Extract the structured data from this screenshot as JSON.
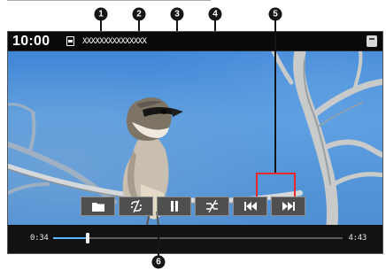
{
  "status_bar": {
    "clock": "10:00",
    "filename": "XXXXXXXXXXXXXXX",
    "media_icon": "sd-card-icon",
    "menu_icon": "menu-icon"
  },
  "controls": [
    {
      "id": "folder",
      "icon": "folder-icon"
    },
    {
      "id": "repeat",
      "icon": "repeat-off-icon"
    },
    {
      "id": "play-pause",
      "icon": "pause-icon"
    },
    {
      "id": "shuffle",
      "icon": "shuffle-off-icon"
    },
    {
      "id": "previous",
      "icon": "skip-previous-icon"
    },
    {
      "id": "next",
      "icon": "skip-next-icon"
    }
  ],
  "seek": {
    "current_time": "0:34",
    "total_time": "4:43",
    "progress": 0.12
  },
  "callouts": [
    "1",
    "2",
    "3",
    "4",
    "5",
    "6"
  ],
  "colors": {
    "badge": "#151515",
    "bracket": "#e8282b",
    "progress_fill": "#58b7ff",
    "button_bg": "#4f4f4f"
  }
}
